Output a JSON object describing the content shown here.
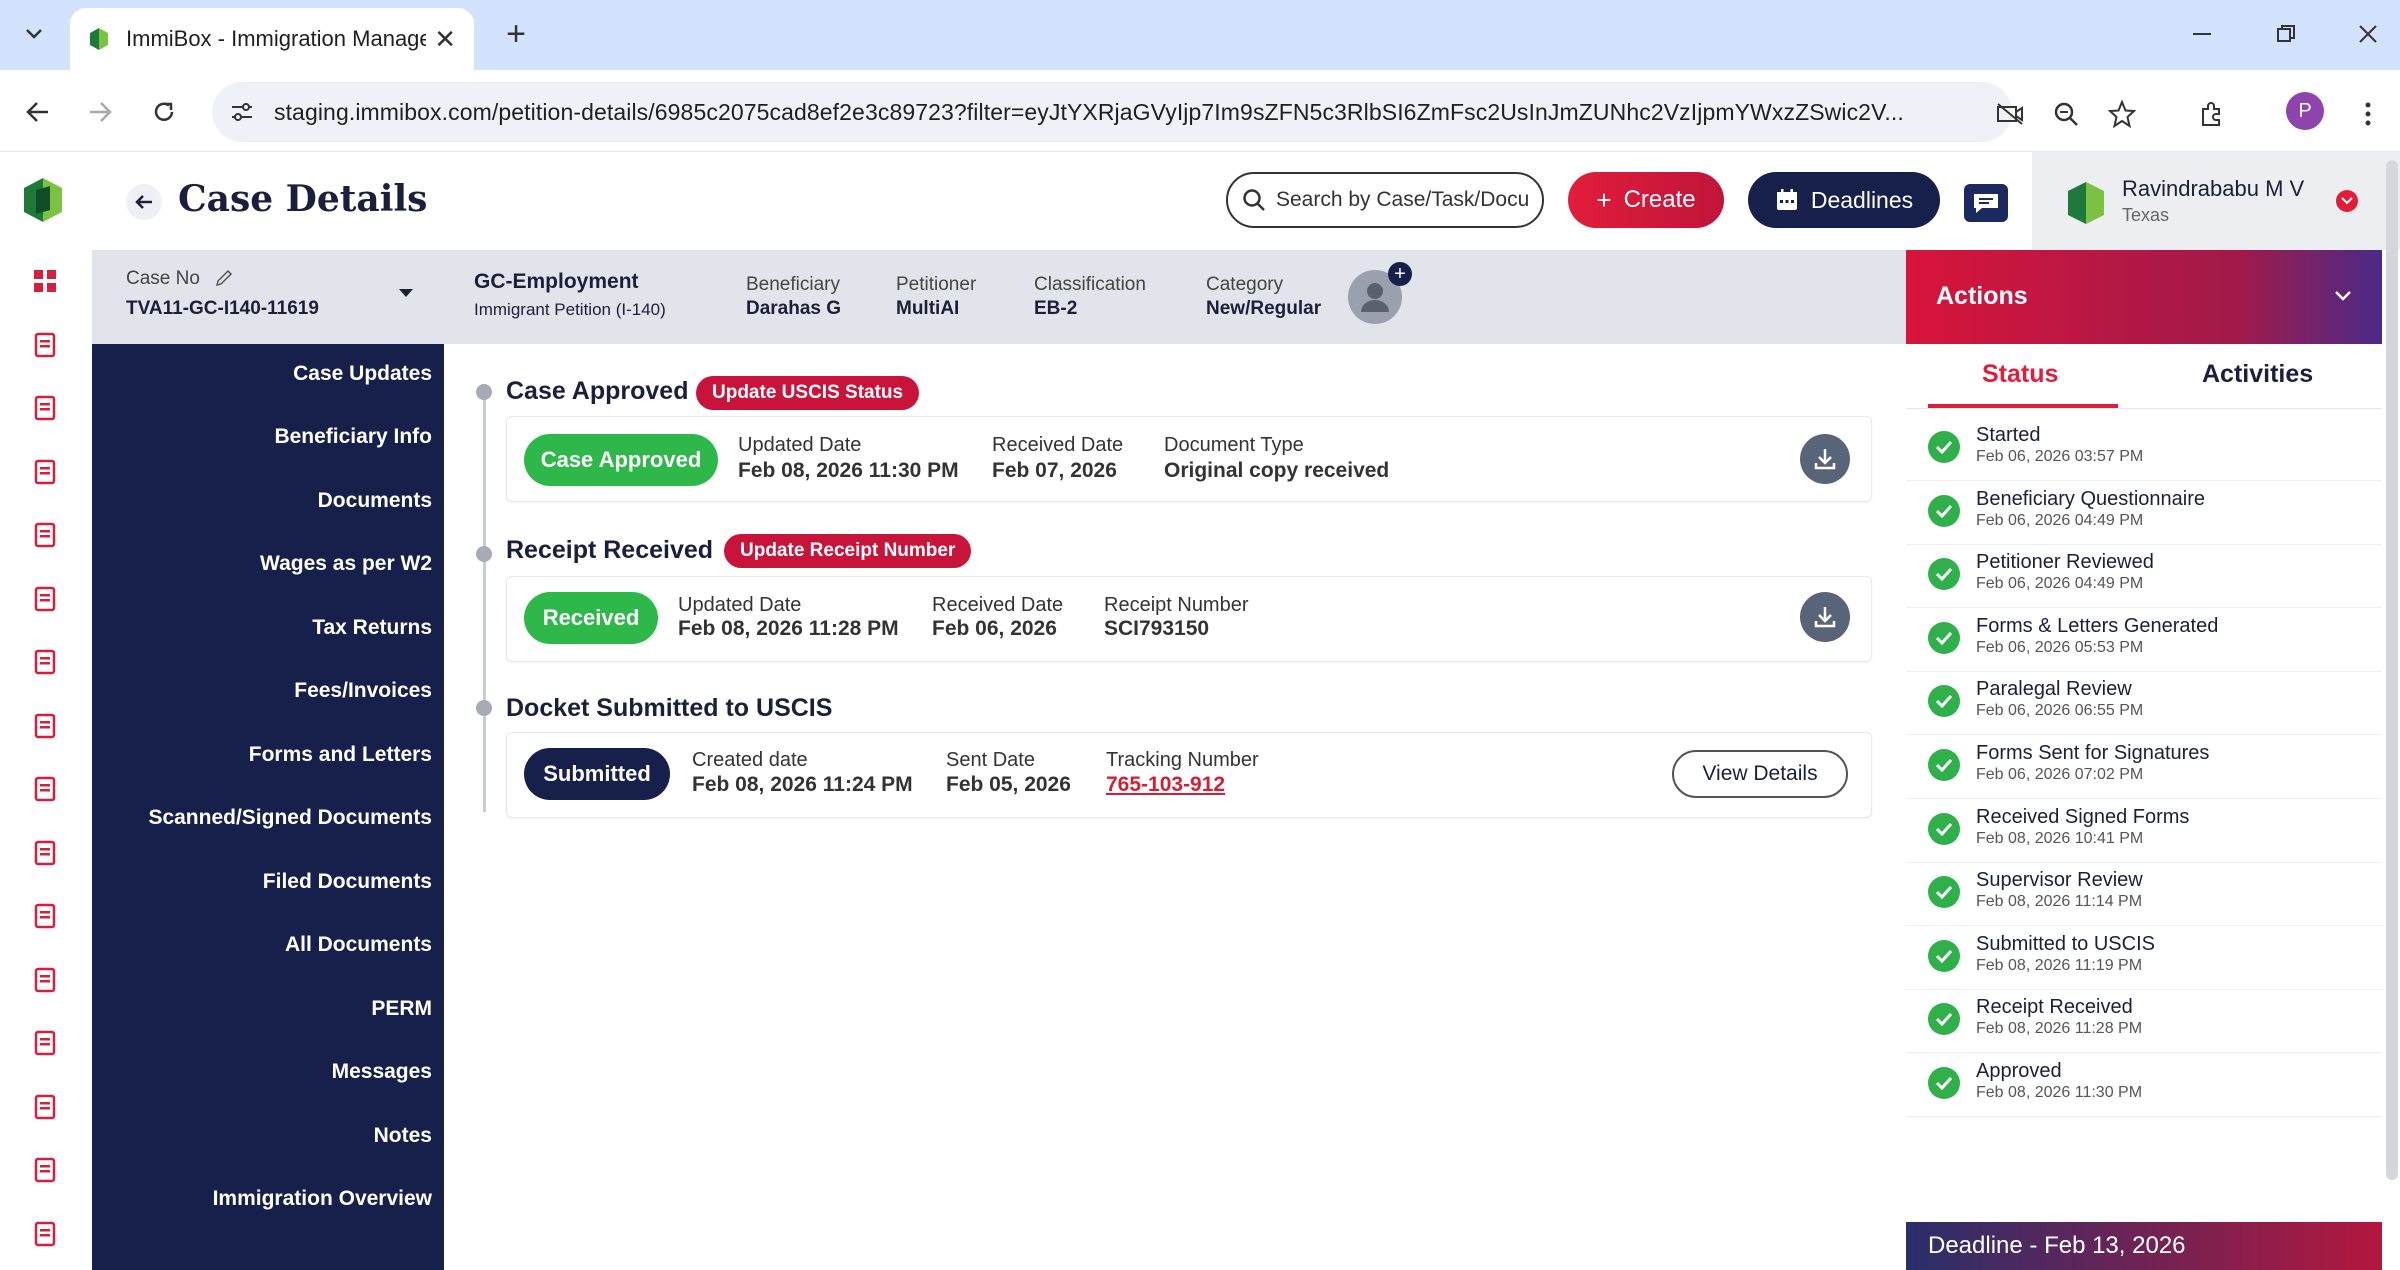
{
  "browser": {
    "tab_title": "ImmiBox - Immigration Manage",
    "url": "staging.immibox.com/petition-details/6985c2075cad8ef2e3c89723?filter=eyJtYXRjaGVyIjp7Im9sZFN5c3RlbSI6ZmFsc2UsInJmZUNhc2VzIjpmYWxzZSwic2V...",
    "profile_initial": "P"
  },
  "header": {
    "title": "Case Details",
    "search_placeholder": "Search by Case/Task/Docu",
    "create_label": "Create",
    "deadlines_label": "Deadlines",
    "user_name": "Ravindrababu M V",
    "user_location": "Texas"
  },
  "casebar": {
    "case_no_label": "Case No",
    "case_no_value": "TVA11-GC-I140-11619",
    "case_type": "GC-Employment",
    "case_subtype": "Immigrant Petition (I-140)",
    "beneficiary_label": "Beneficiary",
    "beneficiary_value": "Darahas G",
    "petitioner_label": "Petitioner",
    "petitioner_value": "MultiAI",
    "classification_label": "Classification",
    "classification_value": "EB-2",
    "category_label": "Category",
    "category_value": "New/Regular"
  },
  "leftnav": [
    "Case Updates",
    "Beneficiary Info",
    "Documents",
    "Wages as per W2",
    "Tax Returns",
    "Fees/Invoices",
    "Forms and Letters",
    "Scanned/Signed Documents",
    "Filed Documents",
    "All Documents",
    "PERM",
    "Messages",
    "Notes",
    "Immigration Overview"
  ],
  "main": {
    "approved": {
      "title": "Case Approved",
      "badge": "Update USCIS Status",
      "pill": "Case Approved",
      "f1_label": "Updated Date",
      "f1_value": "Feb 08, 2026 11:30 PM",
      "f2_label": "Received Date",
      "f2_value": "Feb 07, 2026",
      "f3_label": "Document Type",
      "f3_value": "Original copy received"
    },
    "receipt": {
      "title": "Receipt Received",
      "badge": "Update Receipt Number",
      "pill": "Received",
      "f1_label": "Updated Date",
      "f1_value": "Feb 08, 2026 11:28 PM",
      "f2_label": "Received Date",
      "f2_value": "Feb 06, 2026",
      "f3_label": "Receipt Number",
      "f3_value": "SCI793150"
    },
    "docket": {
      "title": "Docket Submitted to USCIS",
      "pill": "Submitted",
      "f1_label": "Created date",
      "f1_value": "Feb 08, 2026 11:24 PM",
      "f2_label": "Sent Date",
      "f2_value": "Feb 05, 2026",
      "f3_label": "Tracking Number",
      "f3_value": "765-103-912",
      "view_label": "View Details"
    }
  },
  "actions": {
    "title": "Actions",
    "tab_status": "Status",
    "tab_activities": "Activities",
    "status_items": [
      {
        "name": "Started",
        "date": "Feb 06, 2026 03:57 PM"
      },
      {
        "name": "Beneficiary Questionnaire",
        "date": "Feb 06, 2026 04:49 PM"
      },
      {
        "name": "Petitioner Reviewed",
        "date": "Feb 06, 2026 04:49 PM"
      },
      {
        "name": "Forms & Letters Generated",
        "date": "Feb 06, 2026 05:53 PM"
      },
      {
        "name": "Paralegal Review",
        "date": "Feb 06, 2026 06:55 PM"
      },
      {
        "name": "Forms Sent for Signatures",
        "date": "Feb 06, 2026 07:02 PM"
      },
      {
        "name": "Received Signed Forms",
        "date": "Feb 08, 2026 10:41 PM"
      },
      {
        "name": "Supervisor Review",
        "date": "Feb 08, 2026 11:14 PM"
      },
      {
        "name": "Submitted to USCIS",
        "date": "Feb 08, 2026 11:19 PM"
      },
      {
        "name": "Receipt Received",
        "date": "Feb 08, 2026 11:28 PM"
      },
      {
        "name": "Approved",
        "date": "Feb 08, 2026 11:30 PM"
      }
    ],
    "deadline": "Deadline - Feb 13, 2026"
  },
  "colors": {
    "brand_red": "#e11d3a",
    "navy": "#17204a",
    "success_green": "#2fb04a"
  }
}
